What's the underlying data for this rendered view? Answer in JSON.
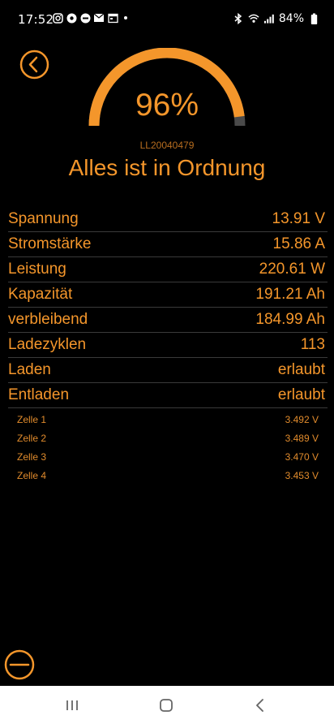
{
  "status_bar": {
    "time": "17:52",
    "battery": "84%",
    "icons_left": [
      "instagram-icon",
      "app-icon-1",
      "app-icon-2",
      "mail-icon",
      "calendar-icon"
    ],
    "icons_right": [
      "bluetooth-icon",
      "wifi-icon",
      "signal-icon",
      "battery-icon"
    ]
  },
  "header": {
    "back_icon": "chevron-left-icon"
  },
  "gauge": {
    "percent_label": "96%",
    "fraction": 0.96,
    "color": "#f4962b",
    "track_color": "#4a4a4a"
  },
  "device": {
    "serial": "LL20040479",
    "state": "Alles ist in Ordnung"
  },
  "measurements": [
    {
      "label": "Spannung",
      "value": "13.91 V"
    },
    {
      "label": "Stromstärke",
      "value": "15.86 A"
    },
    {
      "label": "Leistung",
      "value": "220.61 W"
    },
    {
      "label": "Kapazität",
      "value": "191.21 Ah"
    },
    {
      "label": "verbleibend",
      "value": "184.99 Ah"
    },
    {
      "label": "Ladezyklen",
      "value": "113"
    },
    {
      "label": "Laden",
      "value": "erlaubt"
    },
    {
      "label": "Entladen",
      "value": "erlaubt"
    }
  ],
  "cells": [
    {
      "label": "Zelle 1",
      "value": "3.492 V"
    },
    {
      "label": "Zelle 2",
      "value": "3.489 V"
    },
    {
      "label": "Zelle 3",
      "value": "3.470 V"
    },
    {
      "label": "Zelle 4",
      "value": "3.453 V"
    }
  ],
  "actions": {
    "minus_icon": "minus-circle-icon"
  },
  "nav": {
    "recent_icon": "recent-apps-icon",
    "home_icon": "home-icon",
    "back_icon": "back-icon"
  },
  "colors": {
    "accent": "#f4962b",
    "background": "#000000",
    "divider": "#3a3a3a"
  }
}
